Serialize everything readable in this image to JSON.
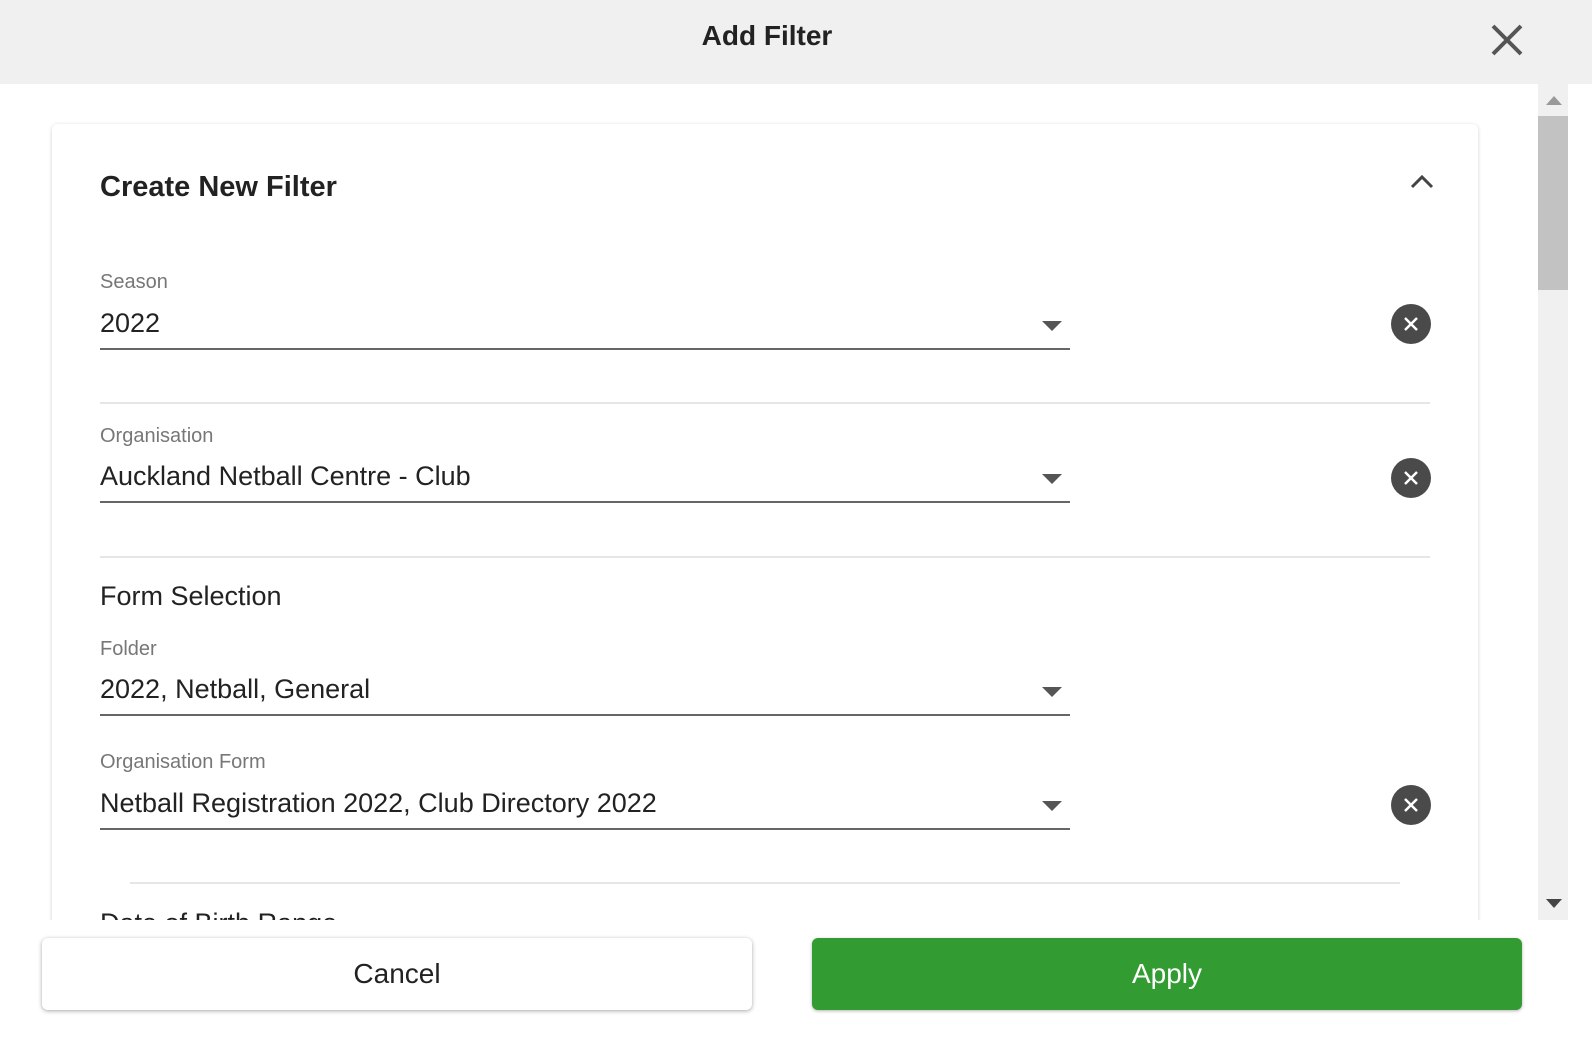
{
  "dialog": {
    "title": "Add Filter",
    "close_icon": "close-icon"
  },
  "card": {
    "title": "Create New Filter",
    "collapse_icon": "chevron-up-icon"
  },
  "fields": {
    "season": {
      "label": "Season",
      "value": "2022"
    },
    "organisation": {
      "label": "Organisation",
      "value": "Auckland Netball Centre - Club"
    },
    "form_selection": {
      "heading": "Form Selection",
      "folder": {
        "label": "Folder",
        "value": "2022, Netball, General"
      },
      "organisation_form": {
        "label": "Organisation Form",
        "value": "Netball Registration 2022, Club Directory 2022"
      }
    },
    "date_of_birth": {
      "heading": "Date of Birth Range"
    }
  },
  "footer": {
    "cancel_label": "Cancel",
    "apply_label": "Apply"
  },
  "colors": {
    "apply": "#329c32",
    "header_bg": "#f0f0f0",
    "clear_button": "#4a4a4a"
  }
}
